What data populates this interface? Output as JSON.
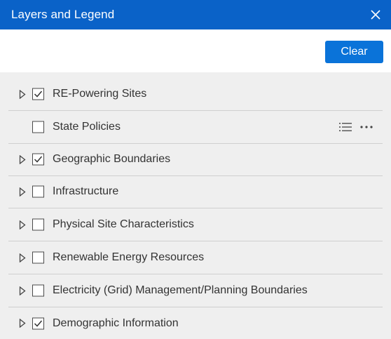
{
  "header": {
    "title": "Layers and Legend",
    "close_icon": "close-icon"
  },
  "toolbar": {
    "clear_label": "Clear"
  },
  "colors": {
    "header_bg": "#0a62c8",
    "button_bg": "#0a73d9",
    "list_bg": "#efefef"
  },
  "layers": [
    {
      "label": "RE-Powering Sites",
      "checked": true,
      "expandable": true
    },
    {
      "label": "State Policies",
      "checked": false,
      "expandable": false,
      "actions": [
        "legend-list-icon",
        "more-options-icon"
      ]
    },
    {
      "label": "Geographic Boundaries",
      "checked": true,
      "expandable": true
    },
    {
      "label": "Infrastructure",
      "checked": false,
      "expandable": true
    },
    {
      "label": "Physical Site Characteristics",
      "checked": false,
      "expandable": true
    },
    {
      "label": "Renewable Energy Resources",
      "checked": false,
      "expandable": true
    },
    {
      "label": "Electricity (Grid) Management/Planning Boundaries",
      "checked": false,
      "expandable": true
    },
    {
      "label": "Demographic Information",
      "checked": true,
      "expandable": true
    }
  ]
}
